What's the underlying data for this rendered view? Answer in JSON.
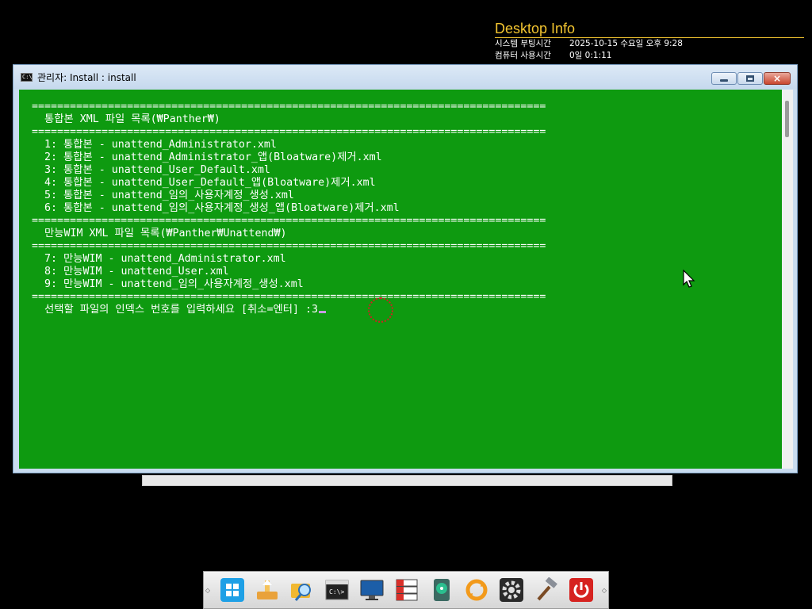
{
  "desktop_info": {
    "title": "Desktop Info",
    "rows": [
      {
        "label": "시스템 부팅시간",
        "value": "2025-10-15 수요일 오후 9:28"
      },
      {
        "label": "컴퓨터 사용시간",
        "value": "0일 0:1:11"
      }
    ]
  },
  "window": {
    "title": "관리자:  Install : install",
    "icon": "cmd-icon",
    "buttons": {
      "minimize": "minimize-button",
      "maximize": "maximize-button",
      "close": "×"
    }
  },
  "console": {
    "lines": [
      "=================================================================================",
      "  통합본 XML 파일 목록(₩Panther₩)",
      "=================================================================================",
      "  1: 통합본 - unattend_Administrator.xml",
      "  2: 통합본 - unattend_Administrator_앱(Bloatware)제거.xml",
      "  3: 통합본 - unattend_User_Default.xml",
      "  4: 통합본 - unattend_User_Default_앱(Bloatware)제거.xml",
      "  5: 통합본 - unattend_임의_사용자계정_생성.xml",
      "  6: 통합본 - unattend_임의_사용자계정_생성_앱(Bloatware)제거.xml",
      "=================================================================================",
      "  만능WIM XML 파일 목록(₩Panther₩Unattend₩)",
      "=================================================================================",
      "  7: 만능WIM - unattend_Administrator.xml",
      "  8: 만능WIM - unattend_User.xml",
      "  9: 만능WIM - unattend_임의_사용자계정_생성.xml",
      "================================================================================="
    ],
    "prompt": "  선택할 파일의 인덱스 번호를 입력하세요 [취소=엔터] :",
    "input_value": "3"
  },
  "colors": {
    "console_bg": "#0e9a10",
    "console_fg": "#ffffff",
    "accent": "#f3c530",
    "highlight_circle": "#d02020"
  },
  "taskbar": {
    "icons": [
      "windows-start-icon",
      "usb-drive-icon",
      "file-search-icon",
      "command-prompt-icon",
      "monitor-icon",
      "drive-manager-icon",
      "disk-tool-icon",
      "refresh-sync-icon",
      "settings-gear-icon",
      "tools-hammer-icon",
      "power-icon"
    ]
  }
}
